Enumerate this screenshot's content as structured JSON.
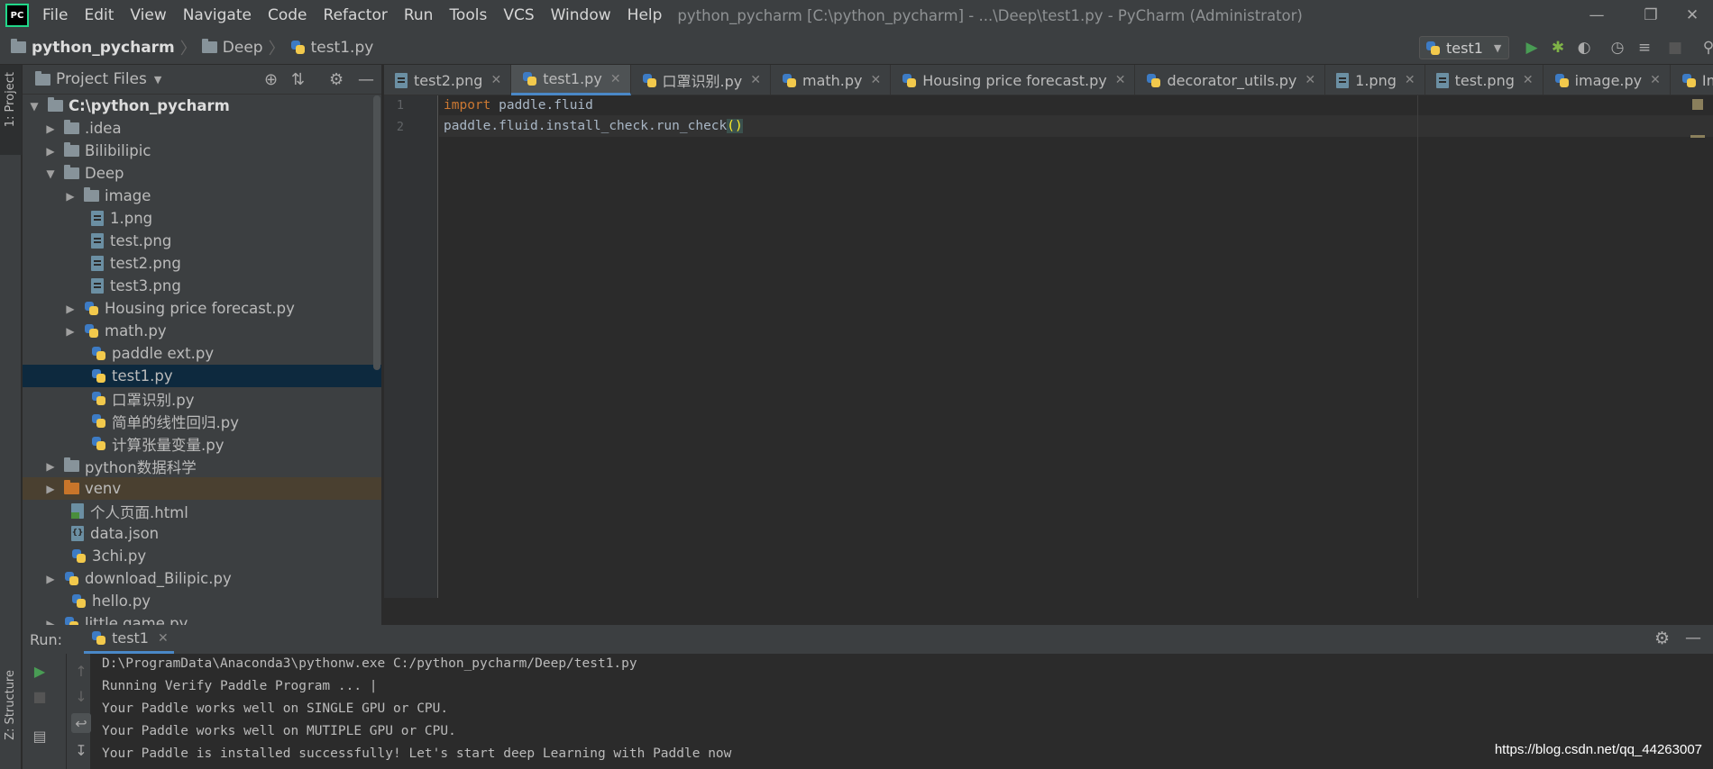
{
  "window": {
    "logo": "PC",
    "title": "python_pycharm [C:\\python_pycharm] - ...\\Deep\\test1.py - PyCharm (Administrator)",
    "menu": [
      "File",
      "Edit",
      "View",
      "Navigate",
      "Code",
      "Refactor",
      "Run",
      "Tools",
      "VCS",
      "Window",
      "Help"
    ]
  },
  "breadcrumb": {
    "root": "python_pycharm",
    "folder": "Deep",
    "file": "test1.py"
  },
  "run_config": "test1",
  "project_panel": {
    "title": "Project Files",
    "stripe_label": "1: Project",
    "rows": [
      {
        "label": "C:\\python_pycharm"
      },
      {
        "label": ".idea"
      },
      {
        "label": "Bilibilipic"
      },
      {
        "label": "Deep"
      },
      {
        "label": "image"
      },
      {
        "label": "1.png"
      },
      {
        "label": "test.png"
      },
      {
        "label": "test2.png"
      },
      {
        "label": "test3.png"
      },
      {
        "label": "Housing price forecast.py"
      },
      {
        "label": "math.py"
      },
      {
        "label": "paddle ext.py"
      },
      {
        "label": "test1.py"
      },
      {
        "label": "口罩识别.py"
      },
      {
        "label": "简单的线性回归.py"
      },
      {
        "label": "计算张量变量.py"
      },
      {
        "label": "python数据科学"
      },
      {
        "label": "venv"
      },
      {
        "label": "个人页面.html"
      },
      {
        "label": "data.json"
      },
      {
        "label": "3chi.py"
      },
      {
        "label": "download_Bilipic.py"
      },
      {
        "label": "hello.py"
      },
      {
        "label": "little game.py"
      }
    ]
  },
  "editor": {
    "tabs": [
      "test2.png",
      "test1.py",
      "口罩识别.py",
      "math.py",
      "Housing price forecast.py",
      "decorator_utils.py",
      "1.png",
      "test.png",
      "image.py",
      "Image.py"
    ],
    "line_numbers": [
      "1",
      "2"
    ],
    "line1_kw": "import",
    "line1_rest": " paddle.fluid",
    "line2_code": "paddle.fluid.install_check.run_check",
    "line2_paren": "()"
  },
  "run_panel": {
    "label": "Run:",
    "tab": "test1",
    "structure_label": "Z: Structure",
    "console": [
      "D:\\ProgramData\\Anaconda3\\pythonw.exe C:/python_pycharm/Deep/test1.py",
      "Running Verify Paddle Program ... |",
      "Your Paddle works well on SINGLE GPU or CPU.",
      "Your Paddle works well on MUTIPLE GPU or CPU.",
      "Your Paddle is installed successfully! Let's start deep Learning with Paddle now"
    ]
  },
  "watermark": "https://blog.csdn.net/qq_44263007",
  "colors": {
    "accent": "#4a88c7",
    "keyword": "#cc7832",
    "run_green": "#499c54"
  }
}
